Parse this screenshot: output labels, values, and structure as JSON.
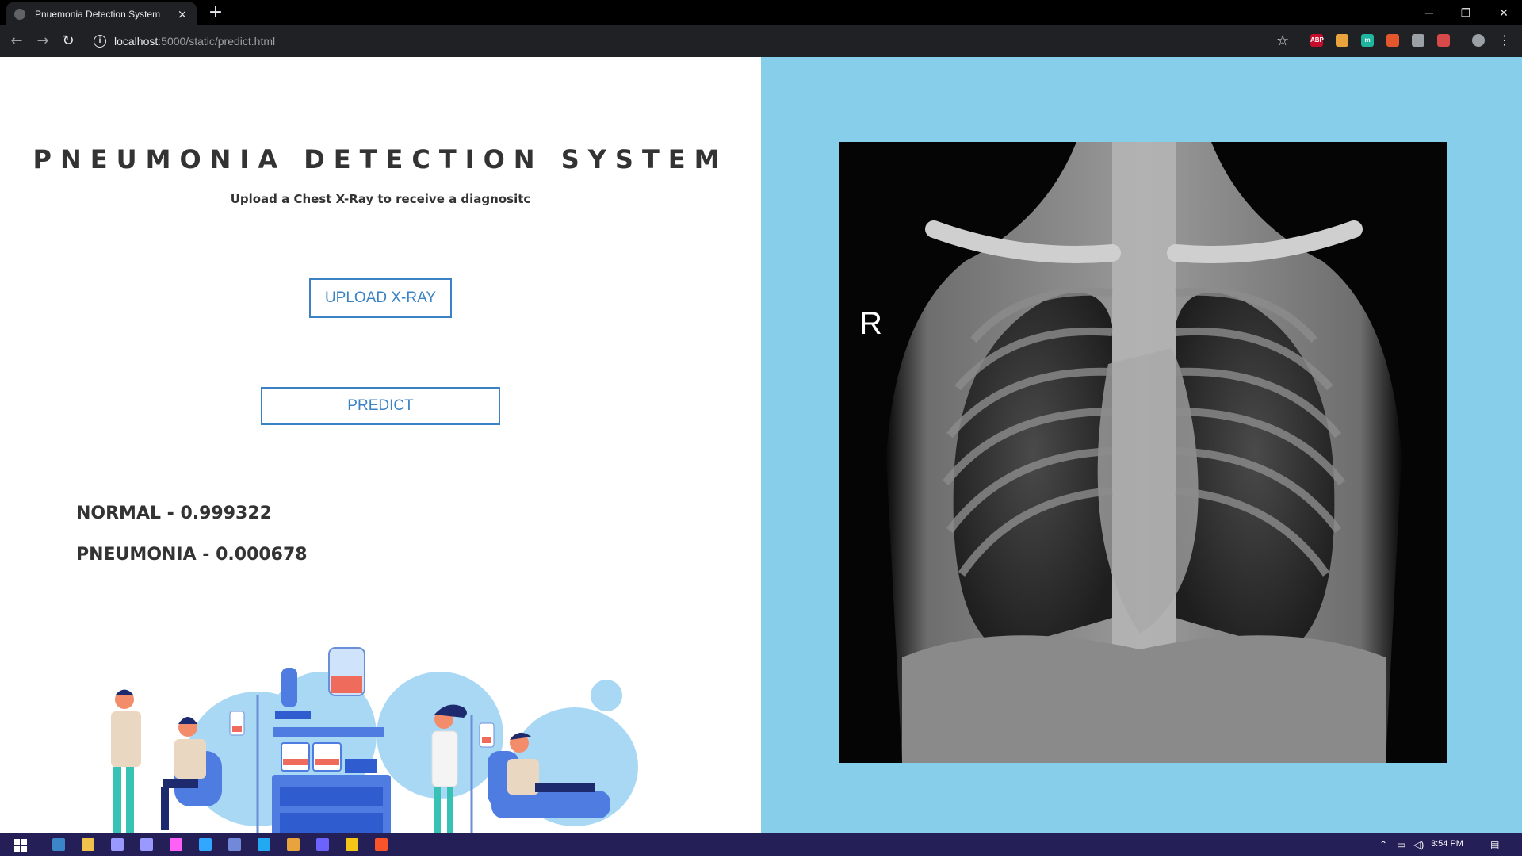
{
  "browser": {
    "tab_title": "Pnuemonia Detection System",
    "tab_close": "×",
    "new_tab": "+",
    "url_host": "localhost",
    "url_path": ":5000/static/predict.html",
    "window_minimize": "─",
    "window_restore": "❐",
    "window_close": "✕",
    "extensions": [
      {
        "name": "adblock-plus-icon",
        "label": "ABP",
        "color": "#c70d2c"
      },
      {
        "name": "extension-icon",
        "label": "",
        "color": "#e8a33d"
      },
      {
        "name": "extension-icon",
        "label": "m",
        "color": "#1fb6a1"
      },
      {
        "name": "extension-icon",
        "label": "",
        "color": "#e4572e"
      },
      {
        "name": "extension-icon",
        "label": "",
        "color": "#9aa0a6"
      },
      {
        "name": "extension-icon",
        "label": "",
        "color": "#d84a4a"
      }
    ]
  },
  "page": {
    "title": "PNEUMONIA DETECTION SYSTEM",
    "subtitle": "Upload a Chest X-Ray to receive a diagnositc",
    "upload_label": "UPLOAD X-RAY",
    "predict_label": "PREDICT",
    "results": [
      {
        "label": "NORMAL - 0.999322"
      },
      {
        "label": "PNEUMONIA - 0.000678"
      }
    ],
    "xray_marker": "R"
  },
  "colors": {
    "accent": "#3b82c4",
    "right_panel": "#87ceeb",
    "heading": "#333333",
    "taskbar": "#241f56"
  },
  "taskbar": {
    "clock": "3:54 PM",
    "apps": [
      {
        "name": "steam-icon",
        "color": "#3a86c8"
      },
      {
        "name": "file-explorer-icon",
        "color": "#f0c24b"
      },
      {
        "name": "premiere-icon",
        "color": "#9999ff"
      },
      {
        "name": "after-effects-icon",
        "color": "#9999ff"
      },
      {
        "name": "xd-icon",
        "color": "#ff61f6"
      },
      {
        "name": "photoshop-icon",
        "color": "#31a8ff"
      },
      {
        "name": "discord-icon",
        "color": "#7289da"
      },
      {
        "name": "vscode-icon",
        "color": "#23a9f2"
      },
      {
        "name": "chrome-icon",
        "color": "#e8a33d"
      },
      {
        "name": "app-icon",
        "color": "#6c63ff"
      },
      {
        "name": "app-icon",
        "color": "#f5c518"
      },
      {
        "name": "brave-icon",
        "color": "#fb542b"
      }
    ]
  }
}
